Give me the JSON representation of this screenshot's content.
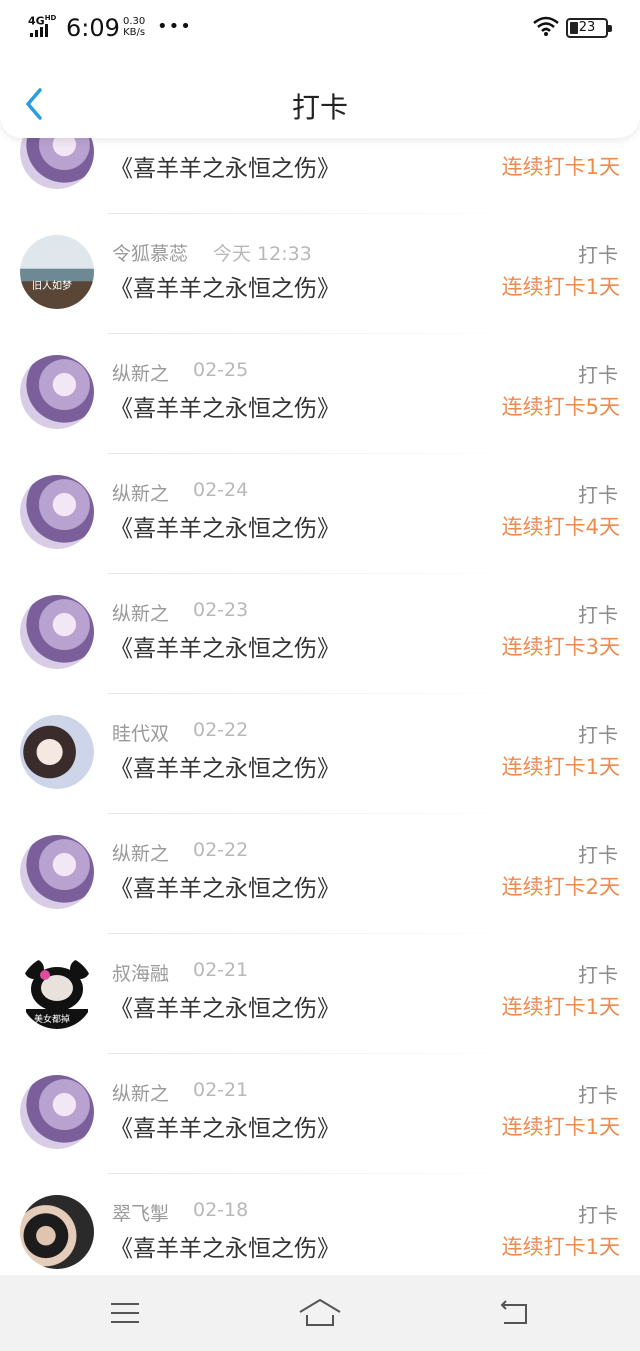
{
  "status_bar": {
    "network": "4G",
    "hd": "HD",
    "time": "6:09",
    "speed_value": "0.30",
    "speed_unit": "KB/s",
    "more": "•••",
    "battery": "23"
  },
  "header": {
    "title": "打卡",
    "back_icon": "chevron-left-icon"
  },
  "rows": [
    {
      "name": "",
      "date": "",
      "book": "《喜羊羊之永恒之伤》",
      "kind": "",
      "streak": "连续打卡1天",
      "avatar": "purple-anime-girl"
    },
    {
      "name": "令狐慕蕊",
      "date": "今天 12:33",
      "book": "《喜羊羊之永恒之伤》",
      "kind": "打卡",
      "streak": "连续打卡1天",
      "avatar": "lake-scene"
    },
    {
      "name": "纵新之",
      "date": "02-25",
      "book": "《喜羊羊之永恒之伤》",
      "kind": "打卡",
      "streak": "连续打卡5天",
      "avatar": "purple-anime-girl"
    },
    {
      "name": "纵新之",
      "date": "02-24",
      "book": "《喜羊羊之永恒之伤》",
      "kind": "打卡",
      "streak": "连续打卡4天",
      "avatar": "purple-anime-girl"
    },
    {
      "name": "纵新之",
      "date": "02-23",
      "book": "《喜羊羊之永恒之伤》",
      "kind": "打卡",
      "streak": "连续打卡3天",
      "avatar": "purple-anime-girl"
    },
    {
      "name": "眭代双",
      "date": "02-22",
      "book": "《喜羊羊之永恒之伤》",
      "kind": "打卡",
      "streak": "连续打卡1天",
      "avatar": "girl-photo"
    },
    {
      "name": "纵新之",
      "date": "02-22",
      "book": "《喜羊羊之永恒之伤》",
      "kind": "打卡",
      "streak": "连续打卡2天",
      "avatar": "purple-anime-girl"
    },
    {
      "name": "叔海融",
      "date": "02-21",
      "book": "《喜羊羊之永恒之伤》",
      "kind": "打卡",
      "streak": "连续打卡1天",
      "avatar": "panda-meme"
    },
    {
      "name": "纵新之",
      "date": "02-21",
      "book": "《喜羊羊之永恒之伤》",
      "kind": "打卡",
      "streak": "连续打卡1天",
      "avatar": "purple-anime-girl"
    },
    {
      "name": "翠飞掣",
      "date": "02-18",
      "book": "《喜羊羊之永恒之伤》",
      "kind": "打卡",
      "streak": "连续打卡1天",
      "avatar": "two-boys-photo"
    }
  ],
  "avatar_text": {
    "lake": "旧人如梦",
    "panda": "美女都掉"
  },
  "bottom_nav": {
    "menu_icon": "menu-icon",
    "home_icon": "home-icon",
    "back_icon": "return-icon"
  },
  "colors": {
    "streak": "#f08a4b",
    "back_chevron": "#2a9ce0",
    "name": "#9a9a9a"
  }
}
